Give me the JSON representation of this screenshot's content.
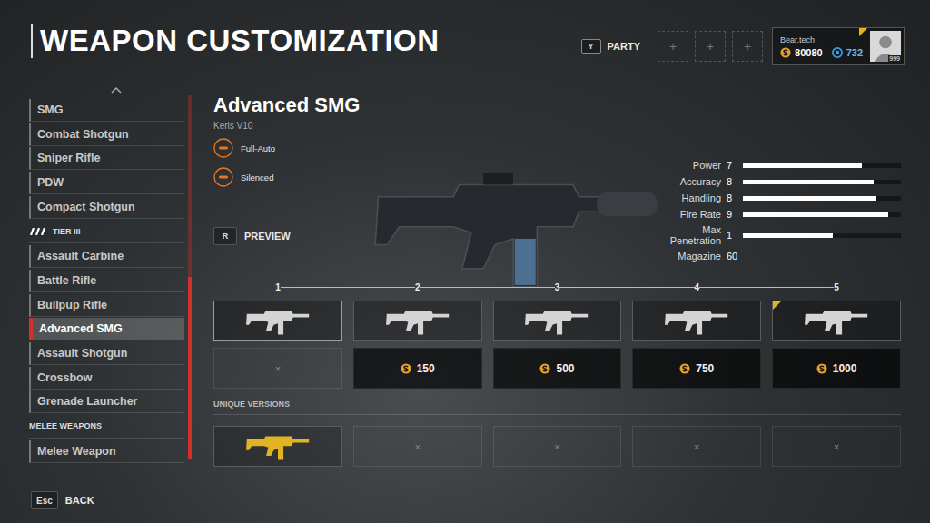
{
  "title": "WEAPON CUSTOMIZATION",
  "party": {
    "key": "Y",
    "label": "PARTY",
    "slots": [
      "+",
      "+",
      "+"
    ]
  },
  "player": {
    "name": "Bear.tech",
    "credits": "80080",
    "premium": "732",
    "level": "999",
    "notification": true
  },
  "sidebar": {
    "items": [
      {
        "kind": "item",
        "label": "SMG",
        "selected": false
      },
      {
        "kind": "item",
        "label": "Combat Shotgun",
        "selected": false
      },
      {
        "kind": "item",
        "label": "Sniper Rifle",
        "selected": false
      },
      {
        "kind": "item",
        "label": "PDW",
        "selected": false
      },
      {
        "kind": "item",
        "label": "Compact Shotgun",
        "selected": false
      },
      {
        "kind": "tier",
        "label": "TIER III",
        "selected": false
      },
      {
        "kind": "item",
        "label": "Assault Carbine",
        "selected": false
      },
      {
        "kind": "item",
        "label": "Battle Rifle",
        "selected": false
      },
      {
        "kind": "item",
        "label": "Bullpup Rifle",
        "selected": false
      },
      {
        "kind": "item",
        "label": "Advanced SMG",
        "selected": true
      },
      {
        "kind": "item",
        "label": "Assault Shotgun",
        "selected": false
      },
      {
        "kind": "item",
        "label": "Crossbow",
        "selected": false
      },
      {
        "kind": "item",
        "label": "Grenade Launcher",
        "selected": false
      },
      {
        "kind": "header",
        "label": "MELEE WEAPONS",
        "selected": false
      },
      {
        "kind": "item",
        "label": "Melee Weapon",
        "selected": false
      }
    ]
  },
  "weapon": {
    "name": "Advanced SMG",
    "model": "Keris V10",
    "traits": [
      {
        "label": "Full-Auto"
      },
      {
        "label": "Silenced"
      }
    ],
    "preview": {
      "key": "R",
      "label": "PREVIEW"
    }
  },
  "stats": [
    {
      "kind": "bar",
      "label": "Power",
      "value": "7",
      "level": 0.75
    },
    {
      "kind": "bar",
      "label": "Accuracy",
      "value": "8",
      "level": 0.83
    },
    {
      "kind": "bar",
      "label": "Handling",
      "value": "8",
      "level": 0.84
    },
    {
      "kind": "bar",
      "label": "Fire Rate",
      "value": "9",
      "level": 0.92
    },
    {
      "kind": "bar",
      "label": "Max Penetration",
      "value": "1",
      "level": 0.57
    },
    {
      "kind": "number",
      "label": "Magazine",
      "value": "60"
    }
  ],
  "variants": [
    {
      "number": "1",
      "selected": true,
      "new": false,
      "unlock": {
        "kind": "empty",
        "text": "×"
      }
    },
    {
      "number": "2",
      "selected": false,
      "new": false,
      "unlock": {
        "kind": "price",
        "text": "150"
      }
    },
    {
      "number": "3",
      "selected": false,
      "new": false,
      "unlock": {
        "kind": "price",
        "text": "500"
      }
    },
    {
      "number": "4",
      "selected": false,
      "new": false,
      "unlock": {
        "kind": "price",
        "text": "750"
      }
    },
    {
      "number": "5",
      "selected": false,
      "new": true,
      "unlock": {
        "kind": "price",
        "text": "1000"
      }
    }
  ],
  "unique": {
    "label": "UNIQUE VERSIONS",
    "slots": [
      {
        "kind": "weapon",
        "text": "",
        "color": "#e3b422"
      },
      {
        "kind": "empty",
        "text": "×",
        "color": "#888888"
      },
      {
        "kind": "empty",
        "text": "×",
        "color": "#888888"
      },
      {
        "kind": "empty",
        "text": "×",
        "color": "#888888"
      },
      {
        "kind": "empty",
        "text": "×",
        "color": "#888888"
      }
    ]
  },
  "back": {
    "key": "Esc",
    "label": "BACK"
  }
}
